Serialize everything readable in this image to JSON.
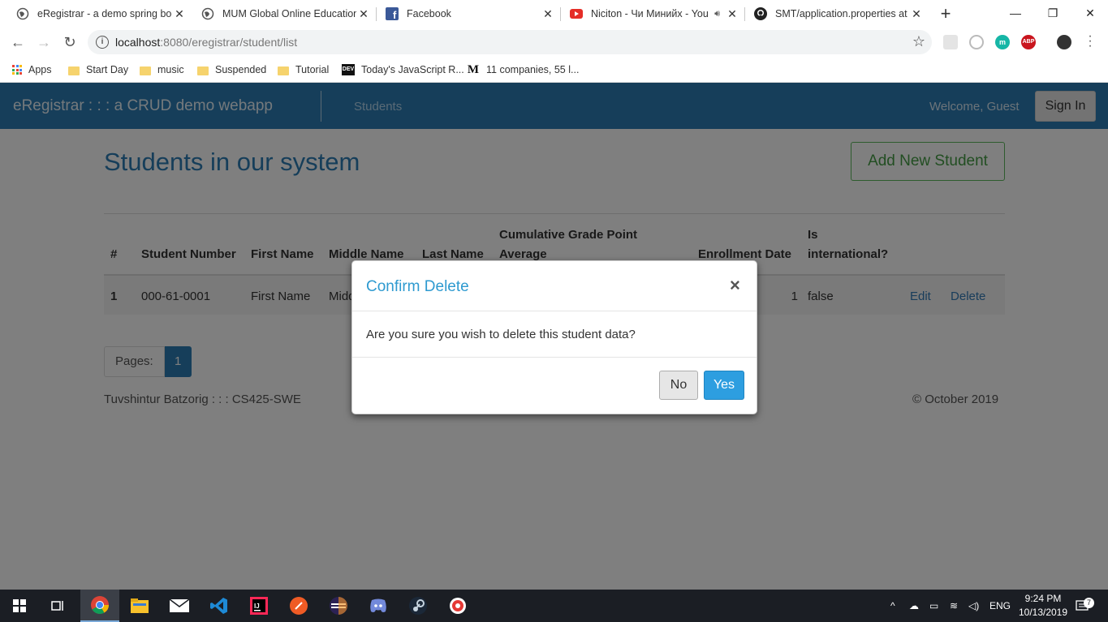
{
  "browser": {
    "tabs": [
      {
        "title": "eRegistrar - a demo spring boo",
        "active": true
      },
      {
        "title": "MUM Global Online Education",
        "active": false
      },
      {
        "title": "Facebook",
        "active": false
      },
      {
        "title": "Niciton - Чи Минийх - You",
        "active": false
      },
      {
        "title": "SMT/application.properties at",
        "active": false
      }
    ],
    "url_host": "localhost",
    "url_rest": ":8080/eregistrar/student/list",
    "bookmarks": [
      {
        "label": "Apps",
        "icon": "apps-grid-icon"
      },
      {
        "label": "Start Day",
        "icon": "folder-icon"
      },
      {
        "label": "music",
        "icon": "folder-icon"
      },
      {
        "label": "Suspended",
        "icon": "folder-icon"
      },
      {
        "label": "Tutorial",
        "icon": "folder-icon"
      },
      {
        "label": "Today's JavaScript R...",
        "icon": "dev-icon"
      },
      {
        "label": "11 companies, 55 l...",
        "icon": "medium-icon"
      }
    ]
  },
  "app": {
    "brand": "eRegistrar : : : a CRUD demo webapp",
    "nav_students": "Students",
    "welcome": "Welcome, Guest",
    "signin": "Sign In",
    "heading": "Students in our system",
    "add_button": "Add New Student",
    "columns": [
      "#",
      "Student Number",
      "First Name",
      "Middle Name",
      "Last Name",
      "Cumulative Grade Point Average",
      "Enrollment Date",
      "Is international?"
    ],
    "rows": [
      {
        "num": "1",
        "student_number": "000-61-0001",
        "first_name": "First Name",
        "middle_name": "Middle Name",
        "last_name": "",
        "cgpa": "",
        "enrollment_date": "1",
        "international": "false",
        "edit": "Edit",
        "delete": "Delete"
      }
    ],
    "pages_label": "Pages:",
    "current_page": "1",
    "footer_left": "Tuvshintur Batzorig : : : CS425-SWE",
    "footer_right": "© October 2019"
  },
  "modal": {
    "title": "Confirm Delete",
    "close": "×",
    "message": "Are you sure you wish to delete this student data?",
    "no": "No",
    "yes": "Yes"
  },
  "taskbar": {
    "language": "ENG",
    "time": "9:24 PM",
    "date": "10/13/2019",
    "notifications": "7"
  },
  "colors": {
    "navbar": "#2c7db4",
    "accent_blue": "#2d9ee0",
    "success_green": "#5cb85c"
  }
}
